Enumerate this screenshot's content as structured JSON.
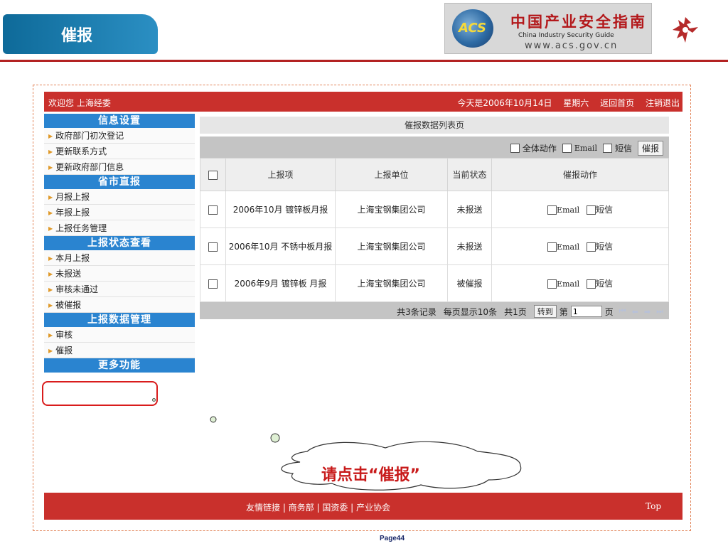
{
  "slide": {
    "title": "催报",
    "logo": {
      "badge": "ACS",
      "cn": "中国产业安全指南",
      "en": "China  Industry  Security  Guide",
      "url": "www.acs.gov.cn"
    },
    "page_number": "Page44"
  },
  "topbar": {
    "welcome": "欢迎您 上海经委",
    "date": "今天是2006年10月14日",
    "weekday": "星期六",
    "home": "返回首页",
    "logout": "注销退出"
  },
  "sidebar": {
    "sections": [
      {
        "title": "信息设置",
        "items": [
          "政府部门初次登记",
          "更新联系方式",
          "更新政府部门信息"
        ]
      },
      {
        "title": "省市直报",
        "items": [
          "月报上报",
          "年报上报",
          "上报任务管理"
        ]
      },
      {
        "title": "上报状态查看",
        "items": [
          "本月上报",
          "未报送",
          "审核未通过",
          "被催报"
        ]
      },
      {
        "title": "上报数据管理",
        "items": [
          "审核",
          "催报"
        ]
      },
      {
        "title": "更多功能",
        "items": []
      }
    ]
  },
  "panel": {
    "title": "催报数据列表页",
    "toolbar": {
      "all": "全体动作",
      "email": "Email",
      "sms": "短信",
      "submit": "催报"
    },
    "columns": [
      "上报项",
      "上报单位",
      "当前状态",
      "催报动作"
    ],
    "rows": [
      {
        "item": "2006年10月 镀锌板月报",
        "unit": "上海宝钢集团公司",
        "status": "未报送"
      },
      {
        "item": "2006年10月 不锈中板月报",
        "unit": "上海宝钢集团公司",
        "status": "未报送"
      },
      {
        "item": "2006年9月 镀锌板 月报",
        "unit": "上海宝钢集团公司",
        "status": "被催报"
      }
    ],
    "row_action": {
      "email": "Email",
      "sms": "短信"
    },
    "pager": {
      "total": "共3条记录",
      "per_page": "每页显示10条",
      "pages": "共1页",
      "goto": "转到",
      "page_prefix": "第",
      "page_value": "1",
      "page_suffix": "页"
    }
  },
  "callout": {
    "text": "请点击“催报”"
  },
  "footer": {
    "links": "友情链接 | 商务部 | 国资委 | 产业协会",
    "top": "Top"
  },
  "colors": {
    "brand_red": "#c9302c",
    "section_blue": "#2a84d0",
    "slide_blue": "#0e6a99",
    "highlight": "#d91c1c"
  }
}
